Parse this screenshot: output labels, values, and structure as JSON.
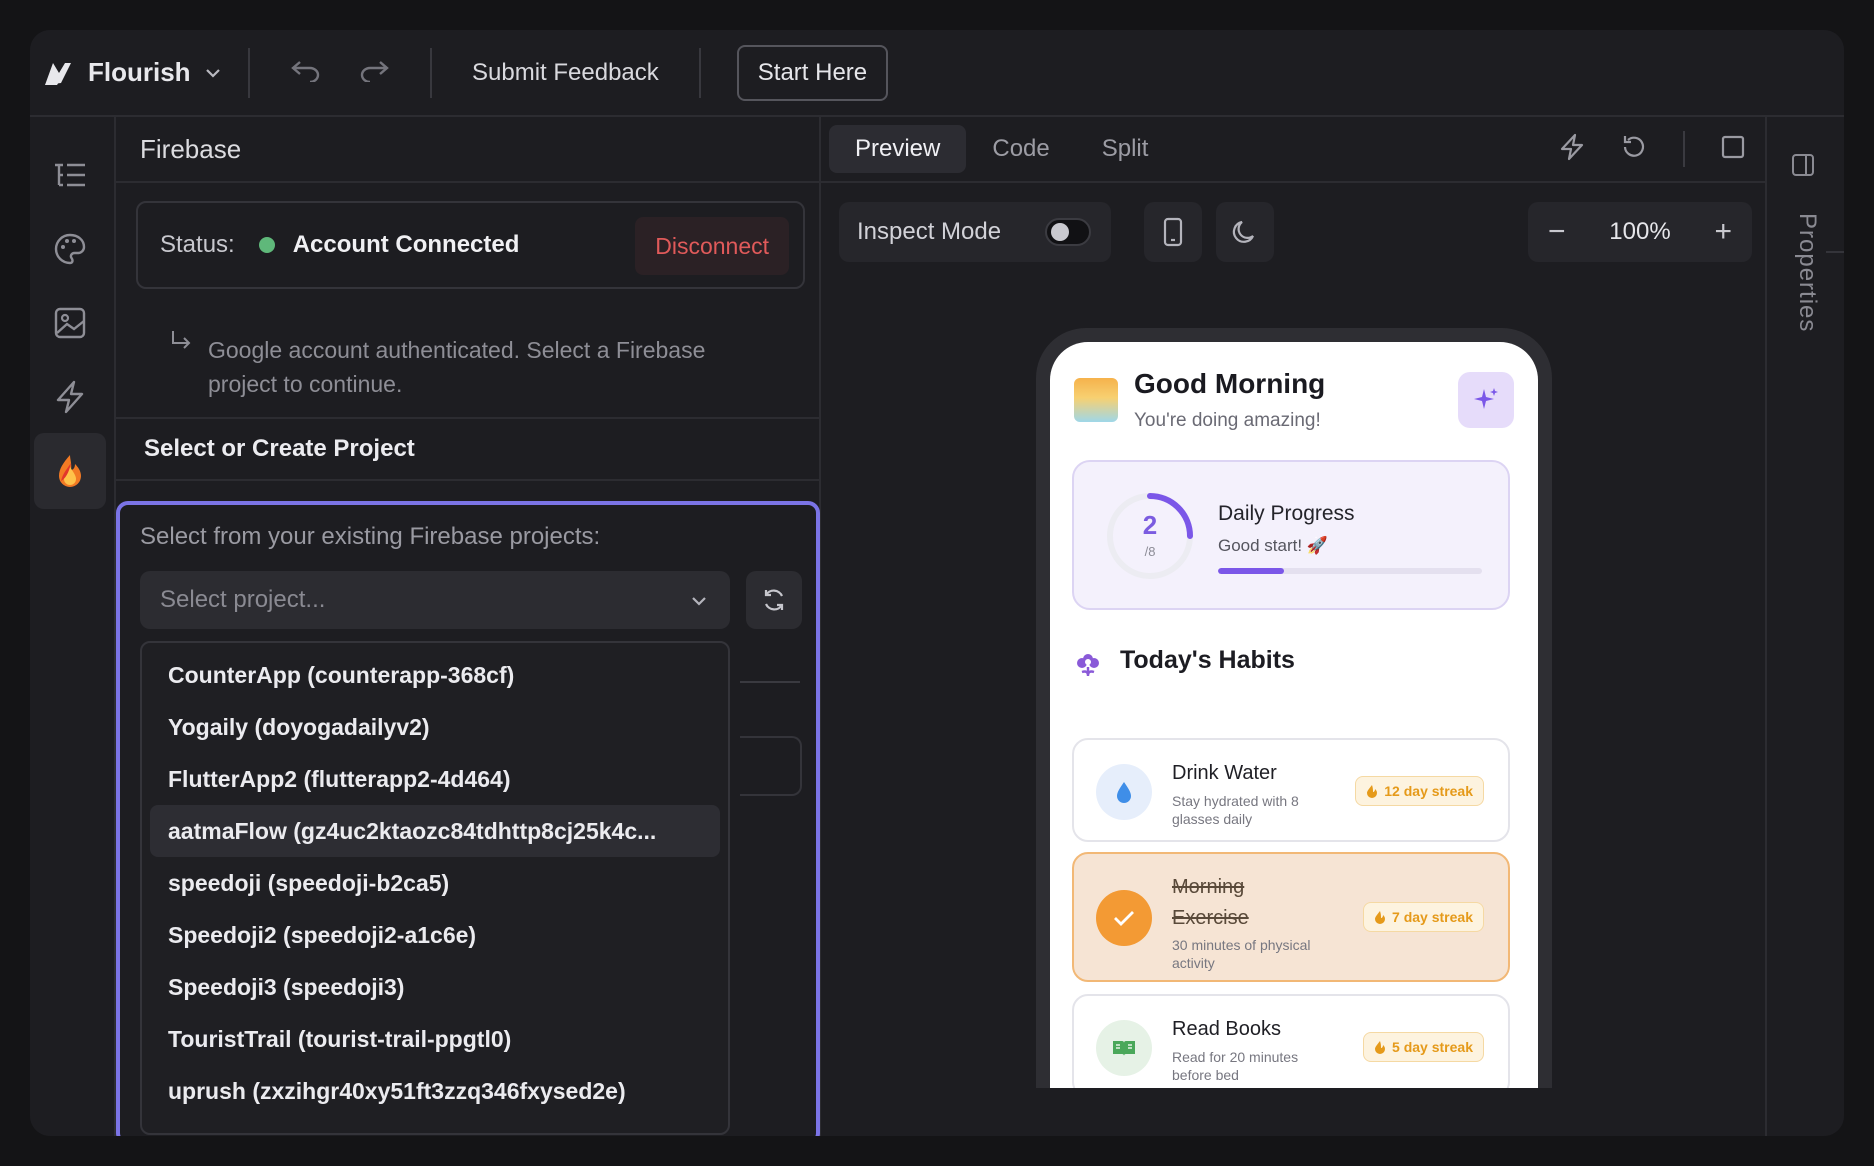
{
  "topbar": {
    "app_name": "Flourish",
    "submit_feedback": "Submit Feedback",
    "start_here": "Start Here"
  },
  "rail": {
    "items": [
      "outline-icon",
      "palette-icon",
      "image-icon",
      "bolt-icon",
      "firebase-icon"
    ],
    "active": "firebase-icon"
  },
  "panel": {
    "title": "Firebase",
    "status_label": "Status:",
    "status_value": "Account Connected",
    "status_color": "#5fb87a",
    "disconnect_label": "Disconnect",
    "auth_note": "Google account authenticated. Select a Firebase project to continue.",
    "section_title": "Select or Create Project",
    "select_hint": "Select from your existing Firebase projects:",
    "select_placeholder": "Select project...",
    "projects": [
      "CounterApp (counterapp-368cf)",
      "Yogaily (doyogadailyv2)",
      "FlutterApp2 (flutterapp2-4d464)",
      "aatmaFlow (gz4uc2ktaozc84tdhttp8cj25k4c...",
      "speedoji (speedoji-b2ca5)",
      "Speedoji2 (speedoji2-a1c6e)",
      "Speedoji3 (speedoji3)",
      "TouristTrail (tourist-trail-ppgtl0)",
      "uprush (zxzihgr40xy51ft3zzq346fxysed2e)"
    ],
    "hovered_index": 3,
    "accent": "#7b74e6"
  },
  "preview": {
    "tabs": [
      "Preview",
      "Code",
      "Split"
    ],
    "active_tab": "Preview",
    "inspect_label": "Inspect Mode",
    "inspect_on": false,
    "zoom": "100%",
    "zoom_minus": "−",
    "zoom_plus": "+"
  },
  "app_preview": {
    "greeting": "Good Morning",
    "greeting_sub": "You're doing amazing!",
    "progress": {
      "title": "Daily Progress",
      "subtitle": "Good start! 🚀",
      "done": "2",
      "total": "/8",
      "fraction": 0.25
    },
    "habits_title": "Today's Habits",
    "habits": [
      {
        "name": "Drink Water",
        "desc": "Stay hydrated with 8 glasses daily",
        "streak": "12 day streak",
        "done": false,
        "icon": "water-drop-icon"
      },
      {
        "name": "Morning Exercise",
        "desc": "30 minutes of physical activity",
        "streak": "7 day streak",
        "done": true,
        "icon": "check-icon"
      },
      {
        "name": "Read Books",
        "desc": "Read for 20 minutes before bed",
        "streak": "5 day streak",
        "done": false,
        "icon": "book-icon"
      }
    ]
  },
  "properties": {
    "label": "Properties"
  }
}
